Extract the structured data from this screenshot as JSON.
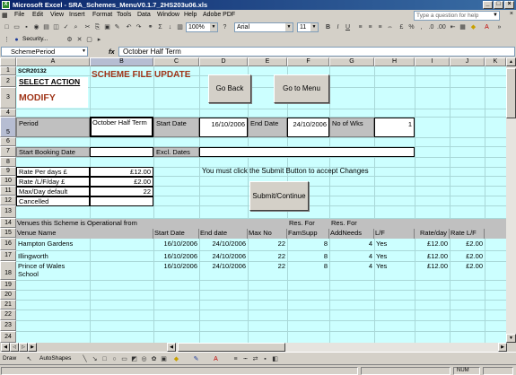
{
  "window": {
    "title": "Microsoft Excel - SRA_Schemes_MenuV0.1.7_2HS203u06.xls"
  },
  "menu": {
    "items": [
      "File",
      "Edit",
      "View",
      "Insert",
      "Format",
      "Tools",
      "Data",
      "Window",
      "Help",
      "Adobe PDF"
    ],
    "help_placeholder": "Type a question for help"
  },
  "toolbar": {
    "zoom": "100%",
    "font": "Arial",
    "font_size": "11",
    "security_label": "Security..."
  },
  "formula_bar": {
    "name_box": "SchemePeriod",
    "fx": "fx",
    "value": "October Half Term"
  },
  "columns": [
    "A",
    "B",
    "C",
    "D",
    "E",
    "F",
    "G",
    "H",
    "I",
    "J",
    "K"
  ],
  "rows": [
    "1",
    "2",
    "3",
    "4",
    "5",
    "6",
    "7",
    "8",
    "9",
    "10",
    "11",
    "12",
    "13",
    "14",
    "15",
    "16",
    "17",
    "18",
    "19",
    "20",
    "21",
    "22",
    "23",
    "24"
  ],
  "sheet": {
    "code": "SCR20132",
    "page_title": "SCHEME FILE UPDATE",
    "select_action_label": "SELECT ACTION",
    "action_value": "MODIFY",
    "go_back": "Go Back",
    "go_to_menu": "Go to Menu",
    "period_label": "Period",
    "period_value": "October Half Term",
    "start_date_label": "Start Date",
    "start_date_value": "16/10/2006",
    "end_date_label": "End Date",
    "end_date_value": "24/10/2006",
    "no_of_wks_label": "No of Wks",
    "no_of_wks_value": "1",
    "start_booking_label": "Start Booking Date",
    "excl_dates_label": "Excl. Dates",
    "rate_per_days_label": "Rate Per days £",
    "rate_per_days_value": "£12.00",
    "rate_lf_label": "Rate /L/F/day £",
    "rate_lf_value": "£2.00",
    "max_day_label": "Max/Day default",
    "max_day_value": "22",
    "cancelled_label": "Cancelled",
    "submit_notice": "You must click the Submit Button to accept Changes",
    "submit_button": "Submit/Continue",
    "venues_title": "Venues this Scheme is Operational from",
    "venue_headers": {
      "res_for_1": "Res. For",
      "res_for_2": "Res. For",
      "venue_name": "Venue Name",
      "start_date": "Start Date",
      "end_date": "End date",
      "max_no": "Max No",
      "fam_supp": "FamSupp",
      "add_needs": "AddNeeds",
      "lf": "L/F",
      "rate_day": "Rate/day",
      "rate_lf": "Rate L/F"
    },
    "venues": [
      {
        "name": "Hampton Gardens",
        "start": "16/10/2006",
        "end": "24/10/2006",
        "max": "22",
        "fam": "8",
        "add": "4",
        "lf": "Yes",
        "rate": "£12.00",
        "rate_lf": "£2.00"
      },
      {
        "name": "Illingworth",
        "start": "16/10/2006",
        "end": "24/10/2006",
        "max": "22",
        "fam": "8",
        "add": "4",
        "lf": "Yes",
        "rate": "£12.00",
        "rate_lf": "£2.00"
      },
      {
        "name": "Prince of Wales",
        "name2": "School",
        "start": "16/10/2006",
        "end": "24/10/2006",
        "max": "22",
        "fam": "8",
        "add": "4",
        "lf": "Yes",
        "rate": "£12.00",
        "rate_lf": "£2.00"
      }
    ]
  },
  "drawing_toolbar": {
    "draw": "Draw",
    "autoshapes": "AutoShapes"
  },
  "status": {
    "num": "NUM"
  }
}
